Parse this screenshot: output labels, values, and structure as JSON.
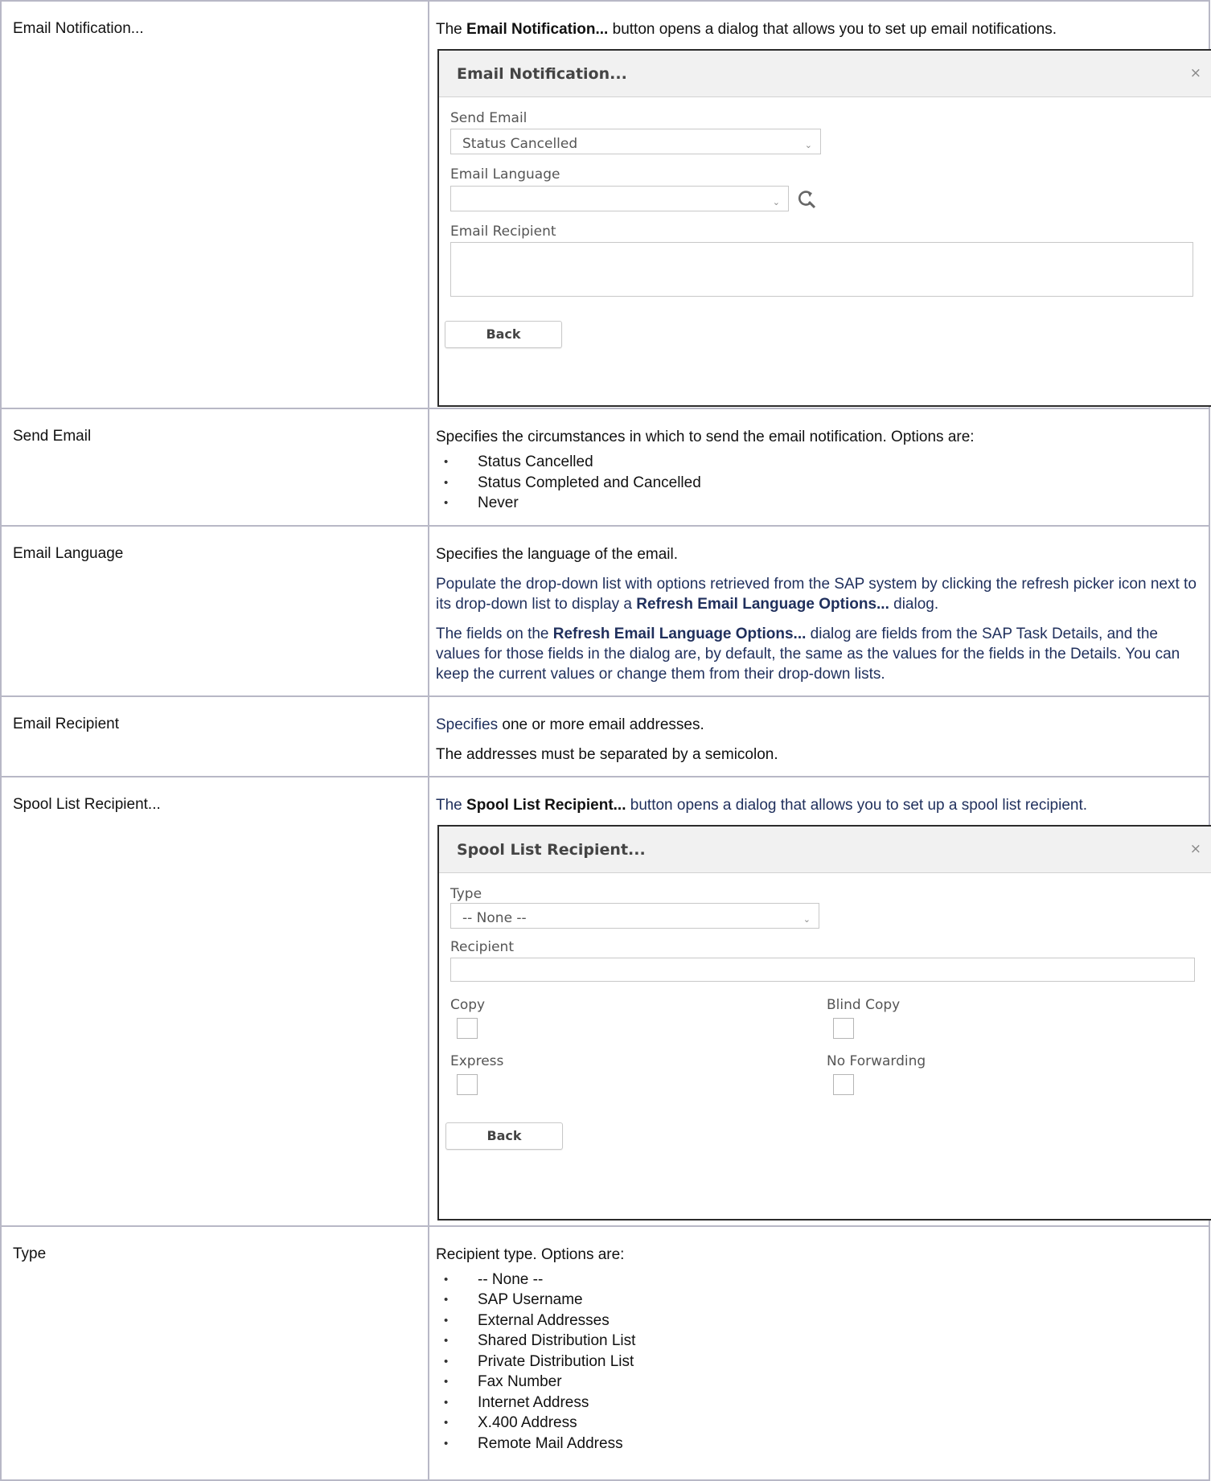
{
  "rows": {
    "email_notification": {
      "term": "Email Notification...",
      "desc_pre": "The ",
      "desc_bold": "Email Notification...",
      "desc_post": " button opens a dialog that allows you to set up email notifications."
    },
    "send_email": {
      "term": "Send Email",
      "desc": "Specifies the circumstances in which to send the email notification. Options are:",
      "options": [
        "Status Cancelled",
        "Status Completed and Cancelled",
        "Never"
      ]
    },
    "email_language": {
      "term": "Email Language",
      "desc1": "Specifies the language of the email.",
      "desc2_pre": "Populate the drop-down list with options retrieved from the SAP system by clicking the refresh picker icon next to its drop-down list to display a ",
      "desc2_bold": "Refresh Email Language Options...",
      "desc2_post": " dialog.",
      "desc3_pre": "The fields on the ",
      "desc3_bold": "Refresh Email Language Options...",
      "desc3_post": " dialog are fields from the SAP Task Details, and the values for those fields in the dialog are, by default, the same as the values for the fields in the Details. You can keep the current values or change them from their drop-down lists."
    },
    "email_recipient": {
      "term": "Email Recipient",
      "desc1_blue": "Specifies",
      "desc1_rest": " one or more email addresses.",
      "desc2": "The addresses must be separated by a semicolon."
    },
    "spool_list": {
      "term": "Spool List Recipient...",
      "desc_pre": "The ",
      "desc_bold": "Spool List Recipient...",
      "desc_post": " button opens a dialog that allows you to set up a spool list recipient."
    },
    "type": {
      "term": "Type",
      "desc": "Recipient type. Options are:",
      "options": [
        "-- None --",
        "SAP Username",
        "External Addresses",
        "Shared Distribution List",
        "Private Distribution List",
        "Fax Number",
        "Internet Address",
        "X.400 Address",
        "Remote Mail Address"
      ]
    }
  },
  "email_dialog": {
    "title": "Email Notification...",
    "close": "×",
    "send_email_label": "Send Email",
    "send_email_value": "Status Cancelled",
    "email_language_label": "Email Language",
    "email_language_value": "",
    "email_recipient_label": "Email Recipient",
    "back_label": "Back"
  },
  "spool_dialog": {
    "title": "Spool List Recipient...",
    "close": "×",
    "type_label": "Type",
    "type_value": "-- None --",
    "recipient_label": "Recipient",
    "copy_label": "Copy",
    "blind_copy_label": "Blind Copy",
    "express_label": "Express",
    "no_forwarding_label": "No Forwarding",
    "back_label": "Back"
  },
  "icons": {
    "caret": "⌄",
    "refresh": "refresh-picker-icon"
  }
}
